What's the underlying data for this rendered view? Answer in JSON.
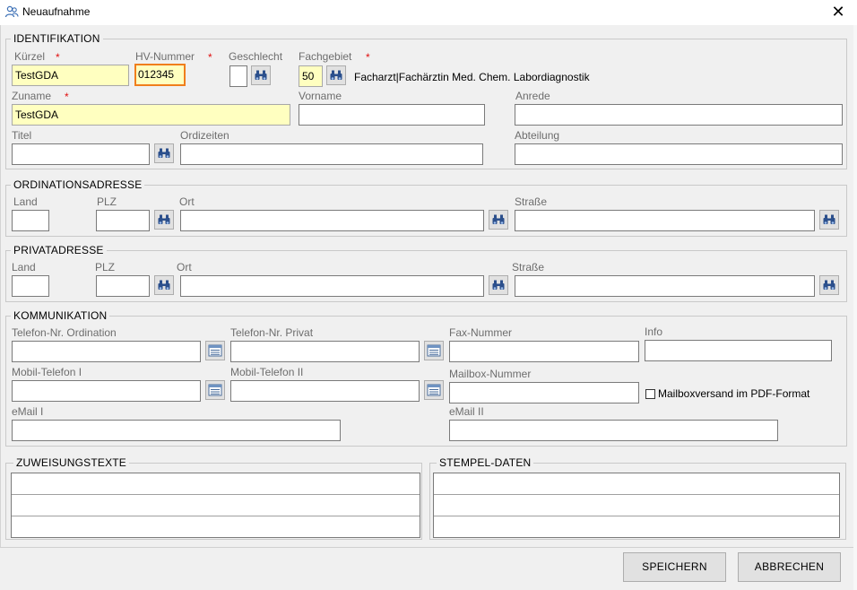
{
  "window": {
    "title": "Neuaufnahme"
  },
  "identifikation": {
    "legend": "IDENTIFIKATION",
    "kuerzel_label": "Kürzel",
    "kuerzel_value": "TestGDA",
    "hv_label": "HV-Nummer",
    "hv_value": "012345",
    "geschlecht_label": "Geschlecht",
    "geschlecht_value": "",
    "fachgebiet_label": "Fachgebiet",
    "fachgebiet_value": "50",
    "fachgebiet_text": "Facharzt|Fachärztin Med. Chem. Labordiagnostik",
    "zuname_label": "Zuname",
    "zuname_value": "TestGDA",
    "vorname_label": "Vorname",
    "vorname_value": "",
    "anrede_label": "Anrede",
    "anrede_value": "",
    "titel_label": "Titel",
    "titel_value": "",
    "ordizeiten_label": "Ordizeiten",
    "ordizeiten_value": "",
    "abteilung_label": "Abteilung",
    "abteilung_value": "",
    "required_marker": "*"
  },
  "ordinationsadresse": {
    "legend": "ORDINATIONSADRESSE",
    "land_label": "Land",
    "plz_label": "PLZ",
    "ort_label": "Ort",
    "strasse_label": "Straße"
  },
  "privatadresse": {
    "legend": "PRIVATADRESSE",
    "land_label": "Land",
    "plz_label": "PLZ",
    "ort_label": "Ort",
    "strasse_label": "Straße"
  },
  "kommunikation": {
    "legend": "KOMMUNIKATION",
    "tel_ord_label": "Telefon-Nr. Ordination",
    "tel_priv_label": "Telefon-Nr. Privat",
    "fax_label": "Fax-Nummer",
    "info_label": "Info",
    "mobil1_label": "Mobil-Telefon I",
    "mobil2_label": "Mobil-Telefon II",
    "mailbox_label": "Mailbox-Nummer",
    "mailbox_pdf_label": "Mailboxversand im PDF-Format",
    "mailbox_pdf_checked": false,
    "email1_label": "eMail I",
    "email2_label": "eMail II"
  },
  "zuweisungstexte": {
    "legend": "ZUWEISUNGSTEXTE"
  },
  "stempel": {
    "legend": "STEMPEL-DATEN"
  },
  "buttons": {
    "save": "SPEICHERN",
    "cancel": "ABBRECHEN"
  },
  "icons": {
    "lookup": "binoculars-icon",
    "list": "list-icon",
    "app": "users-icon",
    "close": "close-icon"
  },
  "colors": {
    "required": "#e01010",
    "focus": "#f07e1c",
    "highlight": "#ffffc0"
  }
}
